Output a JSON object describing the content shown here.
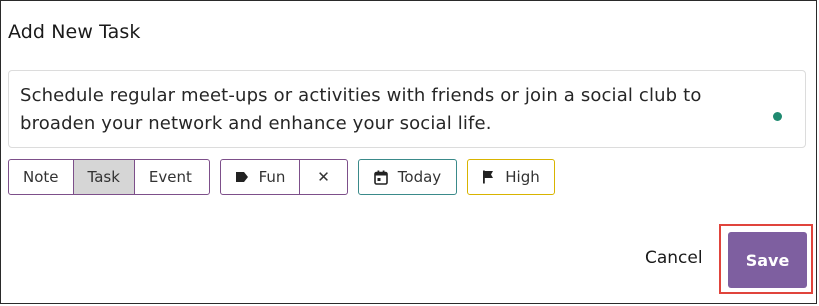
{
  "dialog": {
    "title": "Add New Task",
    "body_text": "Schedule regular meet-ups or activities with friends or join a social club to broaden your network and enhance your social life.",
    "type_options": [
      {
        "label": "Note",
        "selected": false
      },
      {
        "label": "Task",
        "selected": true
      },
      {
        "label": "Event",
        "selected": false
      }
    ],
    "tag": {
      "label": "Fun",
      "icon": "tag-icon",
      "clear_icon": "close-icon",
      "clear_glyph": "✕"
    },
    "due": {
      "label": "Today",
      "icon": "calendar-icon"
    },
    "priority": {
      "label": "High",
      "icon": "flag-icon"
    },
    "actions": {
      "cancel_label": "Cancel",
      "save_label": "Save"
    },
    "colors": {
      "save_button": "#7e5fa0",
      "type_border": "#7d4f8a",
      "date_border": "#3a8a8a",
      "priority_border": "#d8b400",
      "status_dot": "#1f8a70",
      "highlight": "#e0443c"
    }
  }
}
